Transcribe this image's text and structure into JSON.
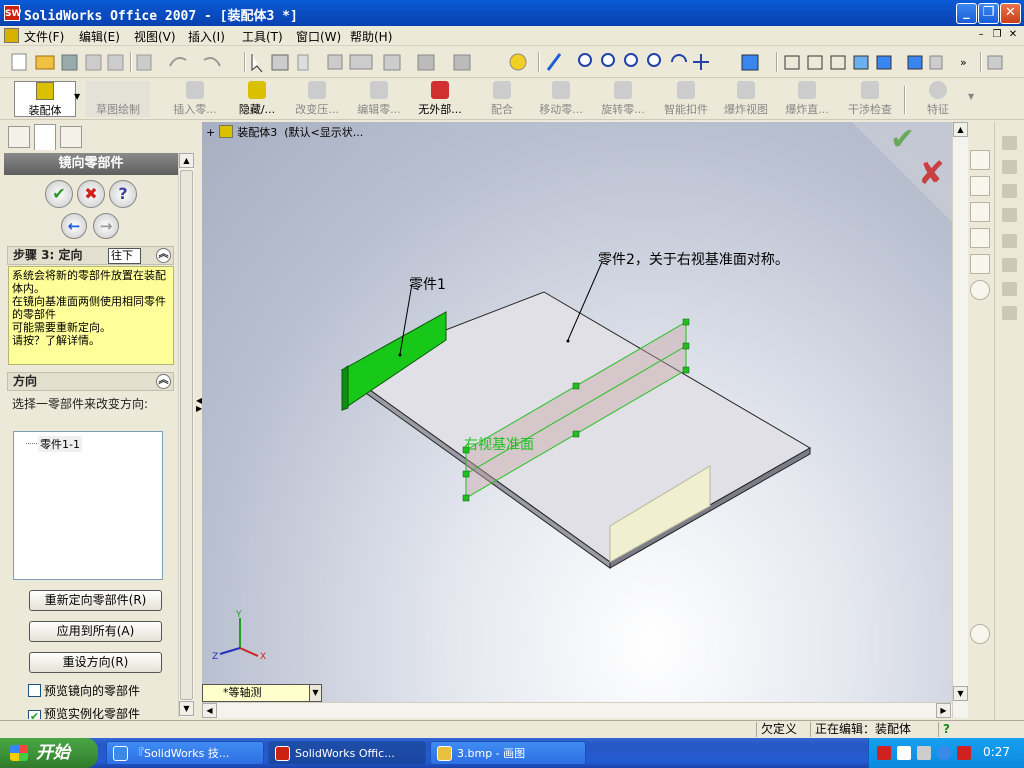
{
  "window": {
    "title": "SolidWorks Office 2007 - [装配体3 *]",
    "app_icon": "SW"
  },
  "menu": [
    "文件(F)",
    "编辑(E)",
    "视图(V)",
    "插入(I)",
    "工具(T)",
    "窗口(W)",
    "帮助(H)"
  ],
  "toolbar2": {
    "items": [
      {
        "label": "装配体",
        "active": true
      },
      {
        "label": "草图绘制",
        "active": false
      },
      {
        "label": "插入零...",
        "active": false
      },
      {
        "label": "隐藏/...",
        "active": true
      },
      {
        "label": "改变压...",
        "active": false
      },
      {
        "label": "编辑零...",
        "active": false
      },
      {
        "label": "无外部...",
        "active": true
      },
      {
        "label": "配合",
        "active": false
      },
      {
        "label": "移动零...",
        "active": false
      },
      {
        "label": "旋转零...",
        "active": false
      },
      {
        "label": "智能扣件",
        "active": false
      },
      {
        "label": "爆炸视图",
        "active": false
      },
      {
        "label": "爆炸直...",
        "active": false
      },
      {
        "label": "干涉检查",
        "active": false
      },
      {
        "label": "特征",
        "active": false
      }
    ]
  },
  "property_manager": {
    "title": "镜向零部件",
    "ok_symbol": "✔",
    "cancel_symbol": "✖",
    "help_symbol": "?",
    "back_symbol": "←",
    "next_symbol": "→",
    "step_group": {
      "title": "步骤 3: 定向",
      "combo": "往下",
      "note": "系统会将新的零部件放置在装配体内。\n在镜向基准面两侧使用相同零件的零部件\n可能需要重新定向。\n请按？了解详情。"
    },
    "direction_group": {
      "title": "方向",
      "description": "选择一零部件来改变方向:",
      "list_items": [
        "零件1-1"
      ]
    },
    "buttons": {
      "reorient": "重新定向零部件(R)",
      "apply_all": "应用到所有(A)",
      "reset": "重设方向(R)"
    },
    "checkboxes": [
      {
        "label": "预览镜向的零部件",
        "checked": false
      },
      {
        "label": "预览实例化零部件",
        "checked": true
      }
    ],
    "collapse_symbol": "︽"
  },
  "viewport": {
    "tree_label": "装配体3",
    "tree_config": "(默认<显示状...",
    "annotation_part1": "零件1",
    "annotation_part2": "零件2，关于右视基准面对称。",
    "plane_label": "右视基准面",
    "ok_mark": "✔",
    "cancel_mark": "✘",
    "triad": {
      "x": "X",
      "y": "Y",
      "z": "Z"
    },
    "view_orientation": "*等轴测"
  },
  "statusbar": {
    "state": "欠定义",
    "editing": "正在编辑：装配体",
    "help": "?"
  },
  "taskbar": {
    "start_label": "开始",
    "tasks": [
      {
        "label": "『SolidWorks 技...",
        "active": false
      },
      {
        "label": "SolidWorks Offic...",
        "active": true
      },
      {
        "label": "3.bmp - 画图",
        "active": false
      }
    ],
    "clock": "0:27"
  },
  "colors": {
    "title_bar": "#0b4fc4",
    "note_bg": "#ffff99",
    "green_part": "#18c818",
    "plane_green": "#20c020"
  }
}
